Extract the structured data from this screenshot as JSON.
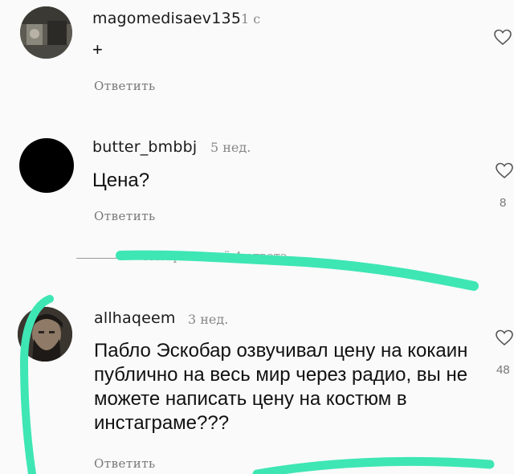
{
  "comments": [
    {
      "username": "magomedisaev135",
      "time": "1 с",
      "text": "+",
      "reply_label": "Ответить",
      "likes": "",
      "avatar": "photo"
    },
    {
      "username": "butter_bmbbj",
      "time": "5 нед.",
      "text": "Цена?",
      "reply_label": "Ответить",
      "likes": "8",
      "avatar": "black-circle"
    },
    {
      "username": "allhaqeem",
      "time": "3 нед.",
      "text": "Пабло Эскобар озвучивал цену на кокаин публично на весь мир через радио, вы не можете написать цену на костюм в инстаграме???",
      "reply_label": "Ответить",
      "likes": "48",
      "avatar": "photo"
    }
  ],
  "view_replies": {
    "label": "Смотреть ещё 4 ответа"
  },
  "icons": {
    "like": "heart-icon"
  },
  "annotation": {
    "color": "#3ee6b4"
  }
}
